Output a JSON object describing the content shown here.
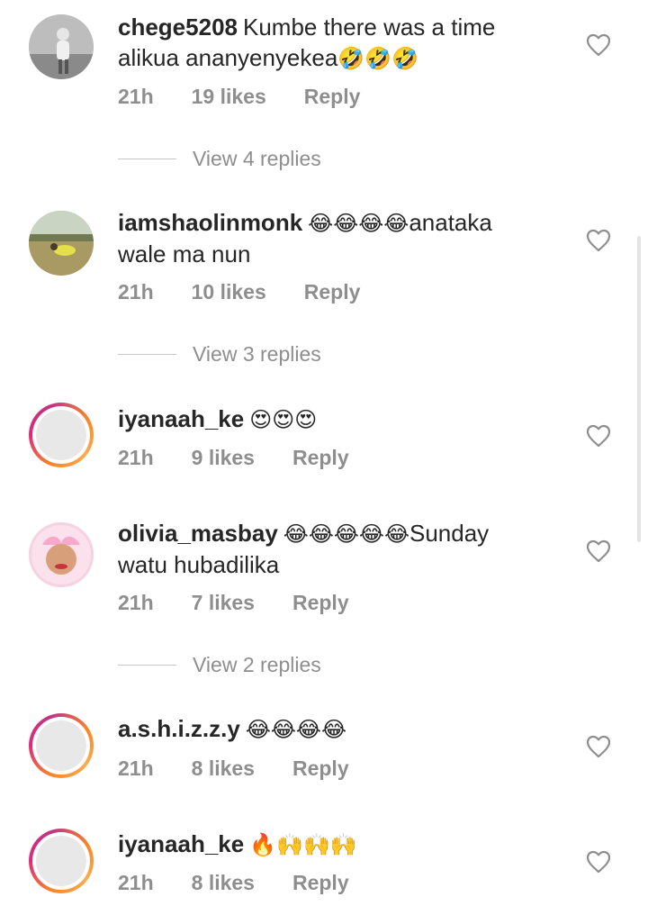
{
  "comments": [
    {
      "username": "chege5208",
      "text": "Kumbe there was a time alikua ananyenyekea",
      "emoji": "🤣🤣🤣",
      "time": "21h",
      "likes": "19 likes",
      "reply": "Reply",
      "view_replies": "View 4 replies"
    },
    {
      "username": "iamshaolinmonk",
      "emoji": "😂😂😂😂",
      "text": "anataka wale ma nun",
      "time": "21h",
      "likes": "10 likes",
      "reply": "Reply",
      "view_replies": "View 3 replies"
    },
    {
      "username": "iyanaah_ke",
      "emoji": "😍😍😍",
      "time": "21h",
      "likes": "9 likes",
      "reply": "Reply"
    },
    {
      "username": "olivia_masbay",
      "emoji": "😂😂😂😂😂",
      "text": "Sunday watu hubadilika",
      "time": "21h",
      "likes": "7 likes",
      "reply": "Reply",
      "view_replies": "View 2 replies"
    },
    {
      "username": "a.s.h.i.z.z.y",
      "emoji": "😂😂😂😂",
      "time": "21h",
      "likes": "8 likes",
      "reply": "Reply"
    },
    {
      "username": "iyanaah_ke",
      "emoji": "🔥🙌🙌🙌",
      "time": "21h",
      "likes": "8 likes",
      "reply": "Reply"
    }
  ],
  "icons": {
    "like": "heart-outline-icon"
  },
  "colors": {
    "text": "#262626",
    "secondary": "#8e8e8e",
    "story_ring": [
      "#f58529",
      "#dd2a7b",
      "#c13584"
    ]
  }
}
